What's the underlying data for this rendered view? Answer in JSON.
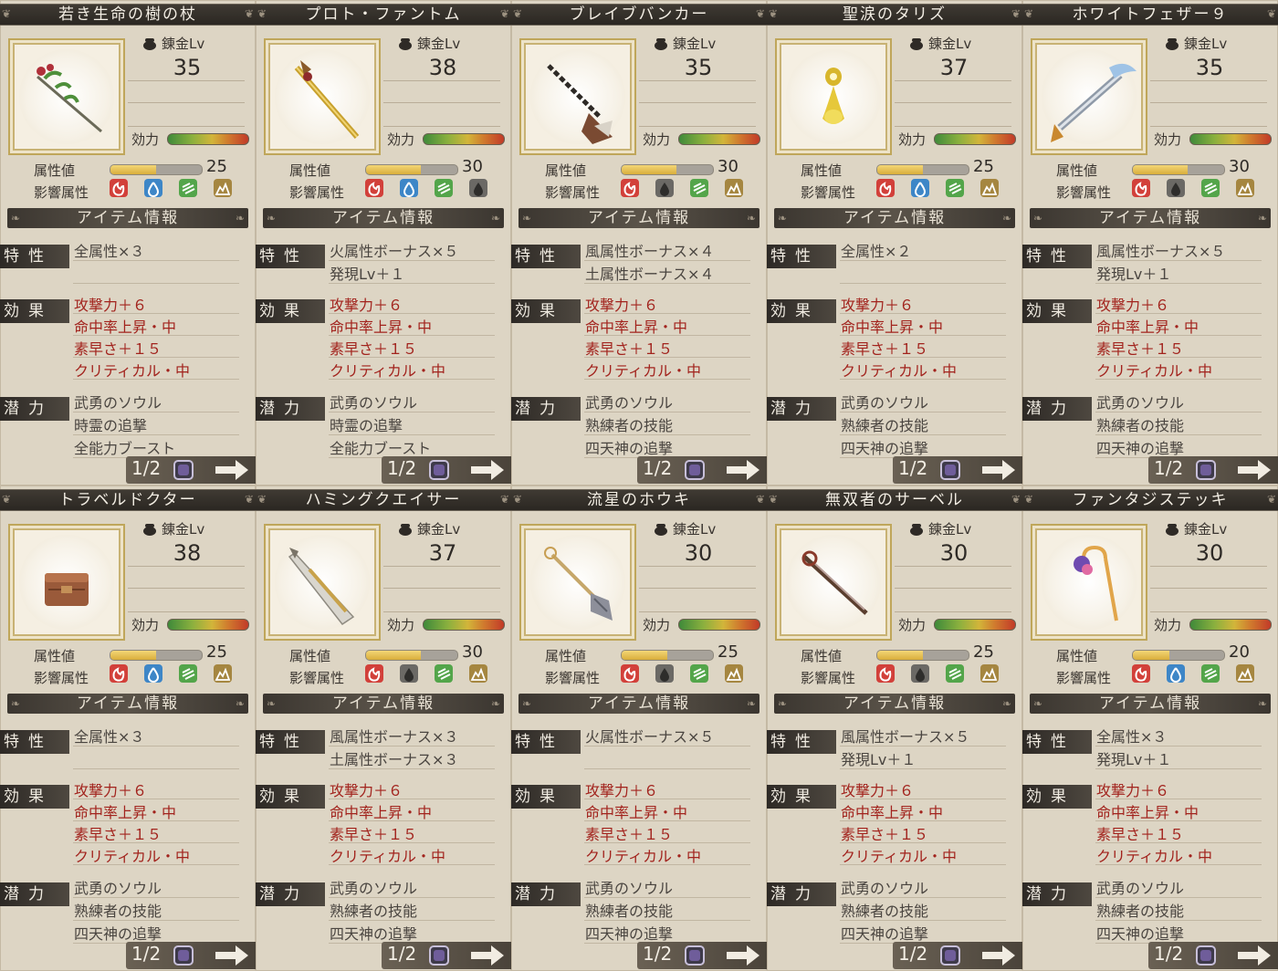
{
  "labels": {
    "alchemy_lv": "錬金Lv",
    "efficacy": "効力",
    "attribute_value": "属性値",
    "influence_attr": "影響属性",
    "item_info": "アイテム情報",
    "trait": "特性",
    "effect": "効果",
    "potential": "潜力"
  },
  "colors": {
    "fire": "#d2403a",
    "water": "#3d86c7",
    "wind": "#53a54a",
    "earth": "#a58640",
    "inactive": "#5b5956",
    "effect_text": "#a2231d",
    "attr_fill": "#e2b84b"
  },
  "items": [
    {
      "name": "若き生命の樹の杖",
      "icon": "staff-icon",
      "alchemy_lv": "35",
      "attr_value": "25",
      "attr_fill": 0.5,
      "elements": [
        "fire",
        "water",
        "wind",
        "earth"
      ],
      "elements_active": [
        true,
        true,
        true,
        true
      ],
      "traits": [
        "全属性×３"
      ],
      "effects": [
        "攻撃力＋６",
        "命中率上昇・中",
        "素早さ＋１５",
        "クリティカル・中"
      ],
      "potentials": [
        "武勇のソウル",
        "時霊の追撃",
        "全能力ブースト"
      ],
      "page": "1/2"
    },
    {
      "name": "プロト・ファントム",
      "icon": "golden-sword-icon",
      "alchemy_lv": "38",
      "attr_value": "30",
      "attr_fill": 0.6,
      "elements": [
        "fire",
        "water",
        "wind",
        "earth"
      ],
      "elements_active": [
        true,
        true,
        true,
        false
      ],
      "traits": [
        "火属性ボーナス×５",
        "発現Lv＋１"
      ],
      "effects": [
        "攻撃力＋６",
        "命中率上昇・中",
        "素早さ＋１５",
        "クリティカル・中"
      ],
      "potentials": [
        "武勇のソウル",
        "時霊の追撃",
        "全能力ブースト"
      ],
      "page": "1/2"
    },
    {
      "name": "ブレイブバンカー",
      "icon": "drill-lance-icon",
      "alchemy_lv": "35",
      "attr_value": "30",
      "attr_fill": 0.6,
      "elements": [
        "fire",
        "water",
        "wind",
        "earth"
      ],
      "elements_active": [
        true,
        false,
        true,
        true
      ],
      "traits": [
        "風属性ボーナス×４",
        "土属性ボーナス×４"
      ],
      "effects": [
        "攻撃力＋６",
        "命中率上昇・中",
        "素早さ＋１５",
        "クリティカル・中"
      ],
      "potentials": [
        "武勇のソウル",
        "熟練者の技能",
        "四天神の追撃"
      ],
      "page": "1/2"
    },
    {
      "name": "聖涙のタリズ",
      "icon": "talisman-icon",
      "alchemy_lv": "37",
      "attr_value": "25",
      "attr_fill": 0.5,
      "elements": [
        "fire",
        "water",
        "wind",
        "earth"
      ],
      "elements_active": [
        true,
        true,
        true,
        true
      ],
      "traits": [
        "全属性×２"
      ],
      "effects": [
        "攻撃力＋６",
        "命中率上昇・中",
        "素早さ＋１５",
        "クリティカル・中"
      ],
      "potentials": [
        "武勇のソウル",
        "熟練者の技能",
        "四天神の追撃"
      ],
      "page": "1/2"
    },
    {
      "name": "ホワイトフェザー９",
      "icon": "feather-gun-icon",
      "alchemy_lv": "35",
      "attr_value": "30",
      "attr_fill": 0.6,
      "elements": [
        "fire",
        "water",
        "wind",
        "earth"
      ],
      "elements_active": [
        true,
        false,
        true,
        true
      ],
      "traits": [
        "風属性ボーナス×５",
        "発現Lv＋１"
      ],
      "effects": [
        "攻撃力＋６",
        "命中率上昇・中",
        "素早さ＋１５",
        "クリティカル・中"
      ],
      "potentials": [
        "武勇のソウル",
        "熟練者の技能",
        "四天神の追撃"
      ],
      "page": "1/2"
    },
    {
      "name": "トラベルドクター",
      "icon": "medical-bag-icon",
      "alchemy_lv": "38",
      "attr_value": "25",
      "attr_fill": 0.5,
      "elements": [
        "fire",
        "water",
        "wind",
        "earth"
      ],
      "elements_active": [
        true,
        true,
        true,
        true
      ],
      "traits": [
        "全属性×３"
      ],
      "effects": [
        "攻撃力＋６",
        "命中率上昇・中",
        "素早さ＋１５",
        "クリティカル・中"
      ],
      "potentials": [
        "武勇のソウル",
        "熟練者の技能",
        "四天神の追撃"
      ],
      "page": "1/2"
    },
    {
      "name": "ハミングクエイサー",
      "icon": "greatsword-icon",
      "alchemy_lv": "37",
      "attr_value": "30",
      "attr_fill": 0.6,
      "elements": [
        "fire",
        "water",
        "wind",
        "earth"
      ],
      "elements_active": [
        true,
        false,
        true,
        true
      ],
      "traits": [
        "風属性ボーナス×３",
        "土属性ボーナス×３"
      ],
      "effects": [
        "攻撃力＋６",
        "命中率上昇・中",
        "素早さ＋１５",
        "クリティカル・中"
      ],
      "potentials": [
        "武勇のソウル",
        "熟練者の技能",
        "四天神の追撃"
      ],
      "page": "1/2"
    },
    {
      "name": "流星のホウキ",
      "icon": "broom-icon",
      "alchemy_lv": "30",
      "attr_value": "25",
      "attr_fill": 0.5,
      "elements": [
        "fire",
        "water",
        "wind",
        "earth"
      ],
      "elements_active": [
        true,
        false,
        true,
        true
      ],
      "traits": [
        "火属性ボーナス×５"
      ],
      "effects": [
        "攻撃力＋６",
        "命中率上昇・中",
        "素早さ＋１５",
        "クリティカル・中"
      ],
      "potentials": [
        "武勇のソウル",
        "熟練者の技能",
        "四天神の追撃"
      ],
      "page": "1/2"
    },
    {
      "name": "無双者のサーベル",
      "icon": "saber-icon",
      "alchemy_lv": "30",
      "attr_value": "25",
      "attr_fill": 0.5,
      "elements": [
        "fire",
        "water",
        "wind",
        "earth"
      ],
      "elements_active": [
        true,
        false,
        true,
        true
      ],
      "traits": [
        "風属性ボーナス×５",
        "発現Lv＋１"
      ],
      "effects": [
        "攻撃力＋６",
        "命中率上昇・中",
        "素早さ＋１５",
        "クリティカル・中"
      ],
      "potentials": [
        "武勇のソウル",
        "熟練者の技能",
        "四天神の追撃"
      ],
      "page": "1/2"
    },
    {
      "name": "ファンタジステッキ",
      "icon": "cane-icon",
      "alchemy_lv": "30",
      "attr_value": "20",
      "attr_fill": 0.4,
      "elements": [
        "fire",
        "water",
        "wind",
        "earth"
      ],
      "elements_active": [
        true,
        true,
        true,
        true
      ],
      "traits": [
        "全属性×３",
        "発現Lv＋１"
      ],
      "effects": [
        "攻撃力＋６",
        "命中率上昇・中",
        "素早さ＋１５",
        "クリティカル・中"
      ],
      "potentials": [
        "武勇のソウル",
        "熟練者の技能",
        "四天神の追撃"
      ],
      "page": "1/2"
    }
  ]
}
